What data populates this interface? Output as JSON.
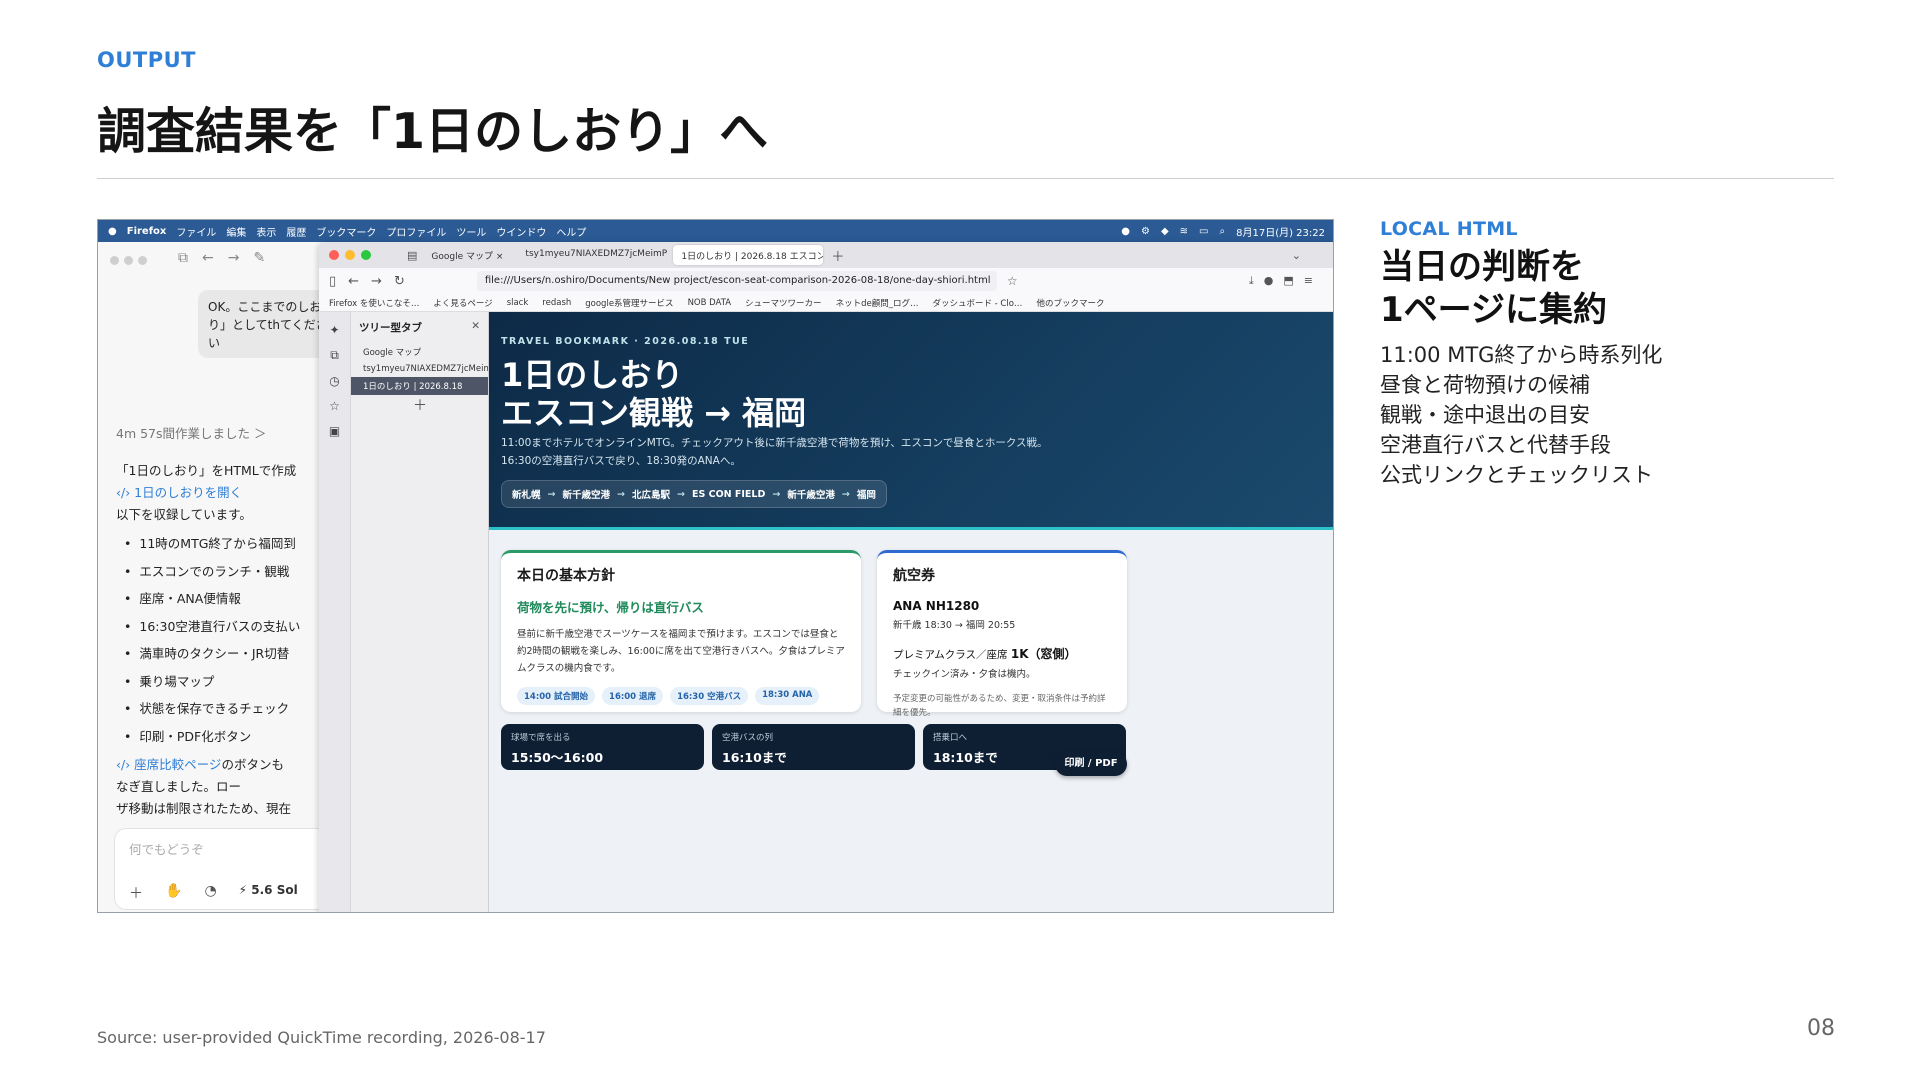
{
  "slide": {
    "eyebrow": "OUTPUT",
    "title": "調査結果を「1日のしおり」へ",
    "source": "Source: user-provided QuickTime recording, 2026-08-17",
    "page_number": "08"
  },
  "side_panel": {
    "eyebrow": "LOCAL HTML",
    "heading_line1": "当日の判断を",
    "heading_line2": "1ページに集約",
    "items": [
      "11:00 MTG終了から時系列化",
      "昼食と荷物預けの候補",
      "観戦・途中退出の目安",
      "空港直行バスと代替手段",
      "公式リンクとチェックリスト"
    ]
  },
  "menubar": {
    "items": [
      "Firefox",
      "ファイル",
      "編集",
      "表示",
      "履歴",
      "ブックマーク",
      "プロファイル",
      "ツール",
      "ウインドウ",
      "ヘルプ"
    ],
    "datetime": "8月17日(月) 23:22"
  },
  "codex": {
    "bubble": "OK。ここまでのしおり」としてthてください",
    "worked": "4m 57s間作業しました ＞",
    "answer_intro": "「1日のしおり」をHTMLで作成",
    "answer_link": "‹/› 1日のしおりを開く",
    "answer_lead": "以下を収録しています。",
    "bullets": [
      "11時のMTG終了から福岡到",
      "エスコンでのランチ・観戦",
      "座席・ANA便情報",
      "16:30空港直行バスの支払い",
      "満車時のタクシー・JR切替",
      "乗り場マップ",
      "状態を保存できるチェック",
      "印刷・PDF化ボタン"
    ],
    "footer_link": "‹/› 座席比較ページ",
    "footer_text": "のボタンも",
    "footer_text2": "なぎ直しました。ロー",
    "footer_text3": "ザ移動は制限されたため、現在",
    "placeholder": "何でもどうぞ",
    "model": "5.6 Sol"
  },
  "firefox": {
    "tabs": [
      "Google マップ",
      "tsy1myeu7NIAXEDMZ7jcMeimPxSh",
      "1日のしおり | 2026.8.18 エスコン観戦"
    ],
    "url": "file:///Users/n.oshiro/Documents/New project/escon-seat-comparison-2026-08-18/one-day-shiori.html",
    "bookmarks": [
      "Firefox を使いこなそ…",
      "よく見るページ",
      "slack",
      "redash",
      "google系管理サービス",
      "NOB DATA",
      "シューマツワーカー",
      "ネットde顧問_ログ…",
      "ダッシュボード - Clo…",
      "他のブックマーク"
    ],
    "sidebar_title": "ツリー型タブ",
    "sidebar_items": [
      "Google マップ",
      "tsy1myeu7NIAXEDMZ7jcMeim",
      "1日のしおり | 2026.8.18"
    ]
  },
  "page": {
    "kicker": "TRAVEL BOOKMARK · 2026.08.18 TUE",
    "title": "1日のしおり\nエスコン観戦 → 福岡",
    "description": "11:00までホテルでオンラインMTG。チェックアウト後に新千歳空港で荷物を預け、エスコンで昼食とホークス戦。16:30の空港直行バスで戻り、18:30発のANAへ。",
    "route": [
      "新札幌",
      "新千歳空港",
      "北広島駅",
      "ES CON FIELD",
      "新千歳空港",
      "福岡"
    ],
    "plan_card": {
      "title": "本日の基本方針",
      "subtitle": "荷物を先に預け、帰りは直行バス",
      "body": "昼前に新千歳空港でスーツケースを福岡まで預けます。エスコンでは昼食と約2時間の観戦を楽しみ、16:00に席を出て空港行きバスへ。夕食はプレミアムクラスの機内食です。",
      "chips": [
        "14:00 試合開始",
        "16:00 退席",
        "16:30 空港バス",
        "18:30 ANA"
      ]
    },
    "flight_card": {
      "title": "航空券",
      "flight": "ANA NH1280",
      "route": "新千歳 18:30 → 福岡 20:55",
      "seat_prefix": "プレミアムクラス／座席 ",
      "seat": "1K（窓側）",
      "checkin": "チェックイン済み・夕食は機内。",
      "note": "予定変更の可能性があるため、変更・取消条件は予約詳細を優先。"
    },
    "timeline": [
      {
        "label": "球場で席を出る",
        "value": "15:50〜16:00"
      },
      {
        "label": "空港バスの列",
        "value": "16:10まで"
      },
      {
        "label": "搭乗口へ",
        "value": "18:10まで"
      }
    ],
    "print_button": "印刷 / PDF"
  }
}
